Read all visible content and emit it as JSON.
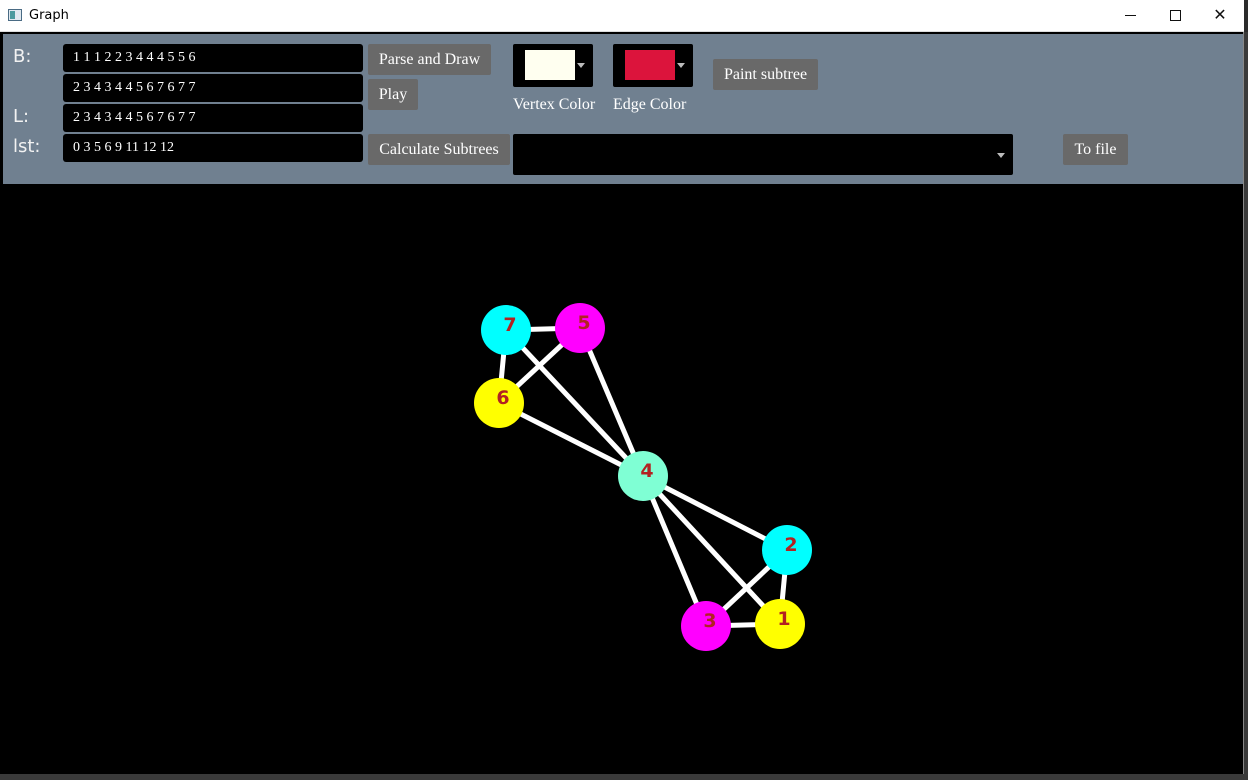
{
  "window": {
    "title": "Graph"
  },
  "labels": {
    "b": "B:",
    "l": "L:",
    "lst": "lst:"
  },
  "fields": {
    "b": "1 1 1 2 2 3 4 4 4 5 5 6",
    "b2": "2 3 4 3 4 4 5 6 7 6 7 7",
    "l": "2 3 4 3 4 4 5 6 7 6 7 7",
    "lst": "0 3 5 6 9 11 12 12"
  },
  "buttons": {
    "parse": "Parse and Draw",
    "play": "Play",
    "calc": "Calculate Subtrees",
    "paint": "Paint subtree",
    "tofile": "To file"
  },
  "pickers": {
    "vertex": {
      "label": "Vertex Color",
      "color": "#fffff0"
    },
    "edge": {
      "label": "Edge Color",
      "color": "#dc143c"
    }
  },
  "subtree_select": {
    "value": ""
  },
  "graph": {
    "vertices": [
      {
        "id": "1",
        "label": "1",
        "color": "#ffff00"
      },
      {
        "id": "2",
        "label": "2",
        "color": "#00ffff"
      },
      {
        "id": "3",
        "label": "3",
        "color": "#ff00ff"
      },
      {
        "id": "4",
        "label": "4",
        "color": "#7fffd4"
      },
      {
        "id": "5",
        "label": "5",
        "color": "#ff00ff"
      },
      {
        "id": "6",
        "label": "6",
        "color": "#ffff00"
      },
      {
        "id": "7",
        "label": "7",
        "color": "#00ffff"
      }
    ],
    "edges": [
      [
        "1",
        "2"
      ],
      [
        "1",
        "3"
      ],
      [
        "1",
        "4"
      ],
      [
        "2",
        "3"
      ],
      [
        "2",
        "4"
      ],
      [
        "3",
        "4"
      ],
      [
        "4",
        "5"
      ],
      [
        "4",
        "6"
      ],
      [
        "4",
        "7"
      ],
      [
        "5",
        "6"
      ],
      [
        "5",
        "7"
      ],
      [
        "6",
        "7"
      ]
    ],
    "edge_color": "#ffffff"
  }
}
